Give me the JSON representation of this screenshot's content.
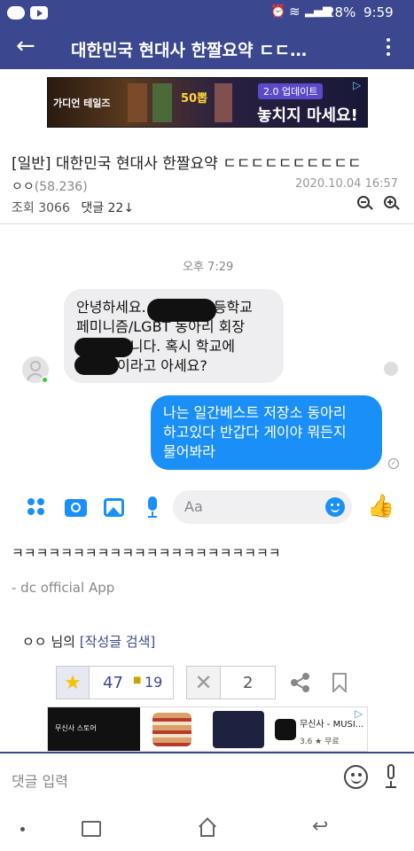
{
  "status": {
    "battery": "28%",
    "time": "9:59"
  },
  "appbar": {
    "title": "대한민국 현대사 한짤요약 ㄷㄷ…"
  },
  "ad_top": {
    "left_text": "가디언 테일즈",
    "center_text": "50뽑",
    "badge": "2.0 업데이트",
    "headline": "놓치지 마세요!"
  },
  "post": {
    "category": "[일반]",
    "title": "대한민국 현대사 한짤요약 ㄷㄷㄷㄷㄷㄷㄷㄷㄷㄷ",
    "author": "ㅇㅇ",
    "ip": "(58.236)",
    "date": "2020.10.04 16:57",
    "views_label": "조회",
    "views": "3066",
    "comments_label": "댓글 22",
    "comments_arrow": "↓"
  },
  "messenger": {
    "time": "오후 7:29",
    "incoming_lines": [
      "안녕하세요.",
      "고등학교",
      "페미니즘/LGBT 동아리 회장",
      "입니다. 혹시 학교에",
      "이라고 아세요?"
    ],
    "outgoing_lines": [
      "나는 일간베스트 저장소 동아리",
      "하고있다 반갑다 게이야 뭐든지",
      "물어봐라"
    ],
    "input_placeholder": "Aa"
  },
  "body": {
    "laugh": "ㅋㅋㅋㅋㅋㅋㅋㅋㅋㅋㅋㅋㅋㅋㅋㅋㅋㅋㅋㅋㅋㅋ",
    "footer": "- dc official App",
    "author_line_prefix": "ㅇㅇ 님의",
    "author_search": "[작성글 검색]"
  },
  "votes": {
    "up": "47",
    "up_fixed": "19",
    "down": "2"
  },
  "ad_bottom": {
    "name": "무신사 - MUSI...",
    "rating": "3.6 ★ 무료",
    "store": "무신사 스토어"
  },
  "comment_input": {
    "placeholder": "댓글 입력"
  },
  "colors": {
    "brand": "#3b4890",
    "bubble_blue": "#1b8ff8",
    "messenger_icon": "#1b8ff8"
  }
}
